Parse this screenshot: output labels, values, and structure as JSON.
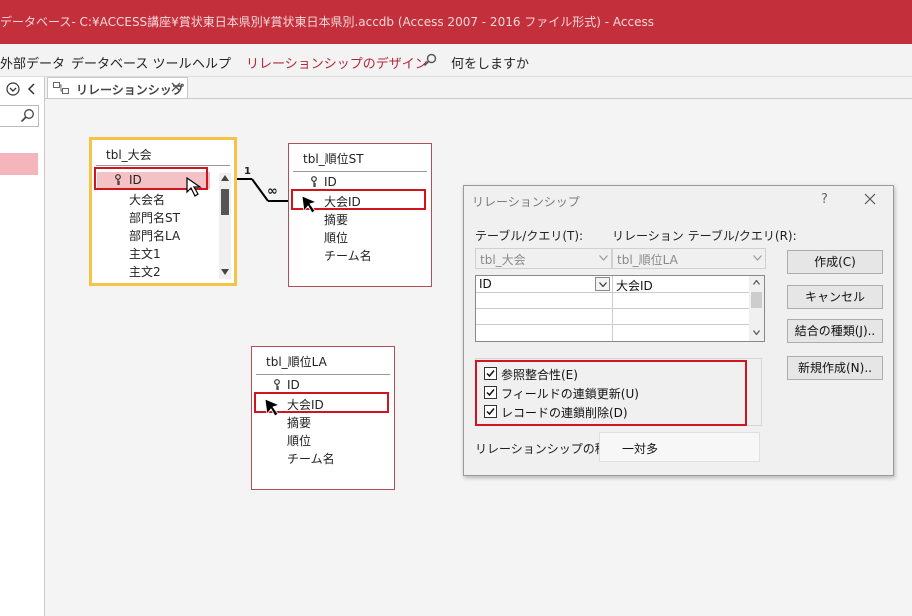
{
  "window": {
    "title": "データベース- C:¥ACCESS講座¥賞状東日本県別¥賞状東日本県別.accdb (Access 2007 - 2016 ファイル形式)  -  Access"
  },
  "ribbon": {
    "tabs": [
      "外部データ",
      "データベース ツール",
      "ヘルプ",
      "リレーションシップのデザイン"
    ],
    "tell_me": "何をしますか"
  },
  "document_tab": {
    "label": "リレーションシップ"
  },
  "tables": {
    "taikai": {
      "title": "tbl_大会",
      "fields": [
        "ID",
        "大会名",
        "部門名ST",
        "部門名LA",
        "主文1",
        "主文2"
      ]
    },
    "juni_st": {
      "title": "tbl_順位ST",
      "fields": [
        "ID",
        "大会ID",
        "摘要",
        "順位",
        "チーム名"
      ]
    },
    "juni_la": {
      "title": "tbl_順位LA",
      "fields": [
        "ID",
        "大会ID",
        "摘要",
        "順位",
        "チーム名"
      ]
    }
  },
  "join_line": {
    "one_label": "1",
    "many_label": "∞"
  },
  "dialog": {
    "title": "リレーションシップ",
    "help": "?",
    "table_label": "テーブル/クエリ(T):",
    "related_label": "リレーション テーブル/クエリ(R):",
    "table_value": "tbl_大会",
    "related_value": "tbl_順位LA",
    "grid_rows": [
      {
        "left": "ID",
        "right": "大会ID"
      }
    ],
    "buttons": {
      "create": "作成(C)",
      "cancel": "キャンセル",
      "join_type": "結合の種類(J)..",
      "create_new": "新規作成(N).."
    },
    "checks": [
      {
        "label": "参照整合性(E)",
        "checked": true
      },
      {
        "label": "フィールドの連鎖更新(U)",
        "checked": true
      },
      {
        "label": "レコードの連鎖削除(D)",
        "checked": true
      }
    ],
    "rel_type_label": "リレーションシップの種類",
    "rel_type_value": "一対多"
  },
  "colors": {
    "accent": "#c32f3a",
    "highlight_box": "#d0151f",
    "selected_table": "#f4c347"
  }
}
